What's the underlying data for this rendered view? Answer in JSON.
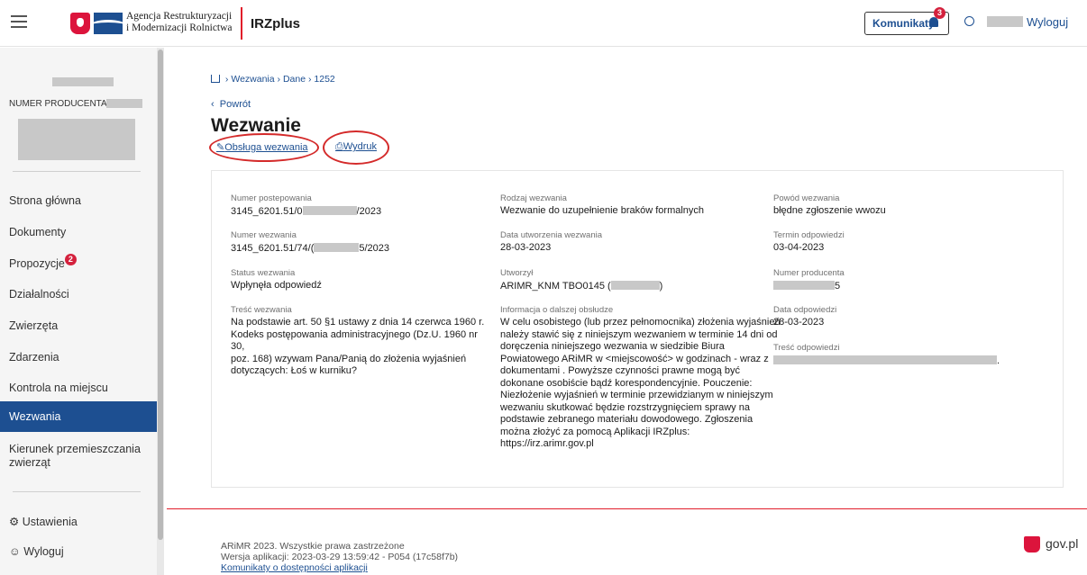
{
  "header": {
    "agency_line1": "Agencja Restrukturyzacji",
    "agency_line2": "i Modernizacji Rolnictwa",
    "app_name": "IRZplus",
    "notifications_label": "Komunikaty",
    "notifications_count": "3",
    "logout_label": "Wyloguj"
  },
  "sidebar": {
    "producer_label": "NUMER PRODUCENTA:",
    "nav": [
      {
        "label": "Strona główna"
      },
      {
        "label": "Dokumenty"
      },
      {
        "label": "Propozycje",
        "badge": "2"
      },
      {
        "label": "Działalności"
      },
      {
        "label": "Zwierzęta"
      },
      {
        "label": "Zdarzenia"
      },
      {
        "label": "Kontrola na miejscu"
      },
      {
        "label": "Wezwania",
        "active": true
      },
      {
        "label": "Kierunek przemieszczania zwierząt"
      }
    ],
    "settings_label": "Ustawienia",
    "logout_label": "Wyloguj"
  },
  "breadcrumb": {
    "items": [
      "Wezwania",
      "Dane",
      "1252"
    ]
  },
  "back_label": "Powrót",
  "page_title": "Wezwanie",
  "actions": {
    "handle_label": "Obsługa wezwania",
    "print_label": "Wydruk"
  },
  "details": {
    "proceeding_number": {
      "label": "Numer postepowania",
      "value_prefix": "3145_6201.51/0",
      "value_suffix": "/2023"
    },
    "call_type": {
      "label": "Rodzaj wezwania",
      "value": "Wezwanie do uzupełnienie braków formalnych"
    },
    "call_reason": {
      "label": "Powód wezwania",
      "value": "błędne zgłoszenie wwozu"
    },
    "call_number": {
      "label": "Numer wezwania",
      "value_prefix": "3145_6201.51/74/(",
      "value_suffix": "5/2023"
    },
    "created_date": {
      "label": "Data utworzenia wezwania",
      "value": "28-03-2023"
    },
    "response_deadline": {
      "label": "Termin odpowiedzi",
      "value": "03-04-2023"
    },
    "status": {
      "label": "Status wezwania",
      "value": "Wpłynęła odpowiedź"
    },
    "created_by": {
      "label": "Utworzył",
      "value_prefix": "ARIMR_KNM TBO0145 (",
      "value_suffix": ")"
    },
    "producer_number": {
      "label": "Numer producenta",
      "value_suffix": "5"
    },
    "content": {
      "label": "Treść wezwania",
      "lines": [
        "Na podstawie art. 50 §1 ustawy z dnia 14 czerwca 1960 r.",
        "Kodeks postępowania administracyjnego (Dz.U. 1960 nr 30,",
        "poz. 168) wzywam Pana/Panią do złożenia wyjaśnień",
        "dotyczących: Łoś w kurniku?"
      ]
    },
    "further_info": {
      "label": "Informacja o dalszej obsłudze",
      "lines": [
        "W celu osobistego (lub przez pełnomocnika) złożenia wyjaśnień",
        "należy stawić się z niniejszym wezwaniem w terminie 14 dni od",
        "doręczenia niniejszego wezwania w siedzibie Biura",
        "Powiatowego ARiMR w <miejscowość> w godzinach - wraz z",
        "dokumentami . Powyższe czynności prawne mogą być",
        "dokonane osobiście bądź korespondencyjnie. Pouczenie:",
        "Niezłożenie wyjaśnień w terminie przewidzianym w niniejszym",
        "wezwaniu skutkować będzie rozstrzygnięciem sprawy na",
        "podstawie zebranego materiału dowodowego. Zgłoszenia",
        "można złożyć za pomocą Aplikacji IRZplus:",
        "https://irz.arimr.gov.pl"
      ]
    },
    "response_date": {
      "label": "Data odpowiedzi",
      "value": "28-03-2023"
    },
    "response_content": {
      "label": "Treść odpowiedzi",
      "value_suffix": "."
    }
  },
  "footer": {
    "copyright": "ARiMR 2023. Wszystkie prawa zastrzeżone",
    "version": "Wersja aplikacji: 2023-03-29 13:59:42 - P054 (17c58f7b)",
    "accessibility_link": "Komunikaty o dostępności aplikacji",
    "govpl_label": "gov.pl"
  }
}
